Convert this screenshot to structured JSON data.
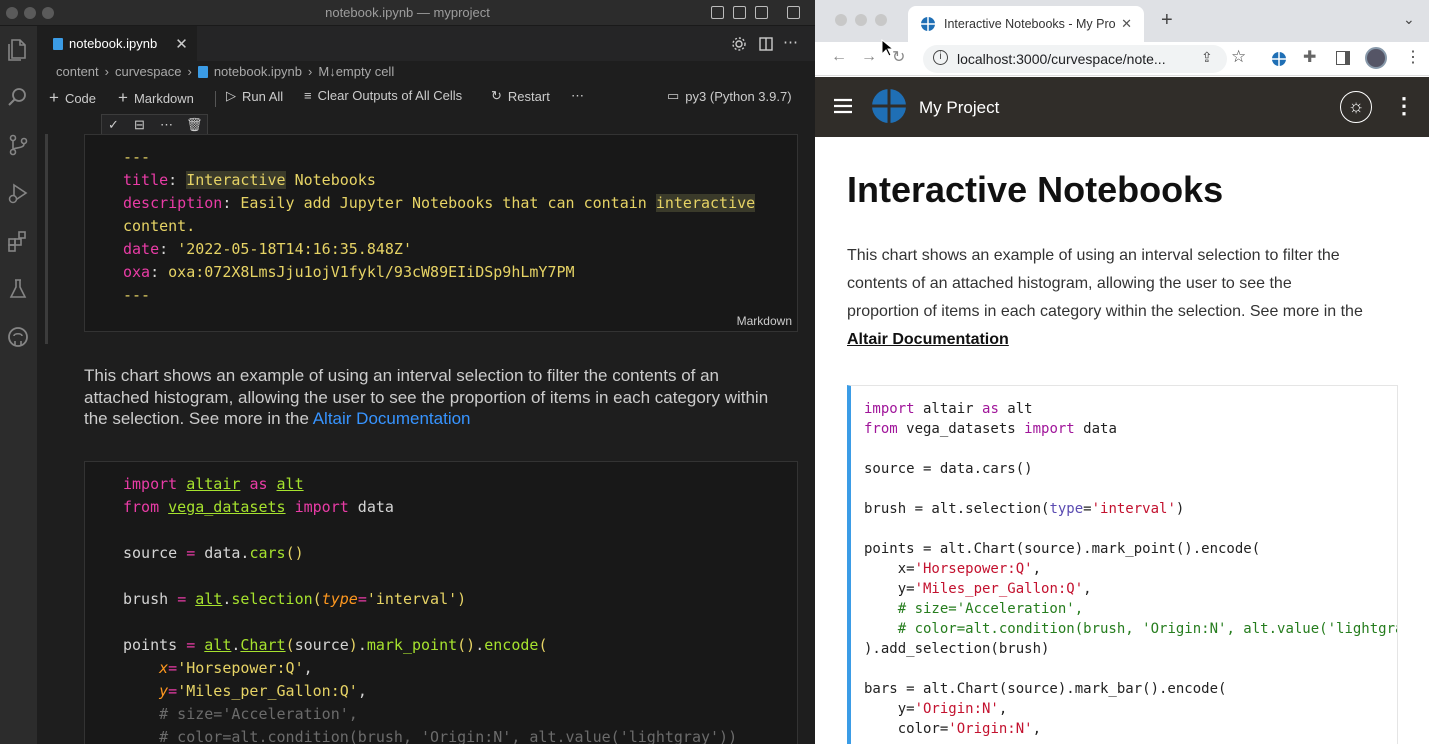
{
  "vscode": {
    "window_title": "notebook.ipynb — myproject",
    "tab": {
      "label": "notebook.ipynb"
    },
    "breadcrumbs": [
      "content",
      "curvespace",
      "notebook.ipynb",
      "M↓empty cell"
    ],
    "toolbar": {
      "code": "Code",
      "markdown": "Markdown",
      "run_all": "Run All",
      "clear_outputs": "Clear Outputs of All Cells",
      "restart": "Restart",
      "kernel": "py3 (Python 3.9.7)"
    },
    "frontmatter": {
      "dashes": "---",
      "title_key": "title",
      "title_val_1": "Interactive",
      "title_val_2": "Notebooks",
      "desc_key": "description",
      "desc_val_1": "Easily add Jupyter Notebooks that can contain",
      "desc_val_2": "interactive",
      "desc_val_3": "content.",
      "date_key": "date",
      "date_val": "'2022-05-18T14:16:35.848Z'",
      "oxa_key": "oxa",
      "oxa_val": "oxa:072X8LmsJju1ojV1fykl/93cW89EIiDSp9hLmY7PM"
    },
    "cell_type": "Markdown",
    "md_text_before": "This chart shows an example of using an interval selection to filter the contents of an attached histogram, allowing the user to see the proportion of items in each category within the selection. See more in the",
    "md_link": "Altair Documentation"
  },
  "browser": {
    "tab_title": "Interactive Notebooks - My Pro",
    "url": "localhost:3000/curvespace/note...",
    "site_title": "My Project",
    "page_title": "Interactive Notebooks",
    "description": "This chart shows an example of using an interval selection to filter the contents of an attached histogram, allowing the user to see the proportion of items in each category within the selection. See more in the",
    "description_link": "Altair Documentation"
  },
  "icons": [
    "files-icon",
    "search-icon",
    "source-control-icon",
    "run-debug-icon",
    "extensions-icon",
    "testing-icon",
    "github-icon",
    "check-icon",
    "split-cell-icon",
    "more-icon",
    "delete-icon",
    "settings-icon",
    "split-editor-icon",
    "back-icon",
    "forward-icon",
    "reload-icon",
    "info-icon",
    "share-icon",
    "star-icon",
    "extensions-puzzle-icon",
    "sidebar-icon",
    "avatar",
    "menu-icon",
    "theme-toggle-icon",
    "kebab-icon",
    "logo"
  ]
}
